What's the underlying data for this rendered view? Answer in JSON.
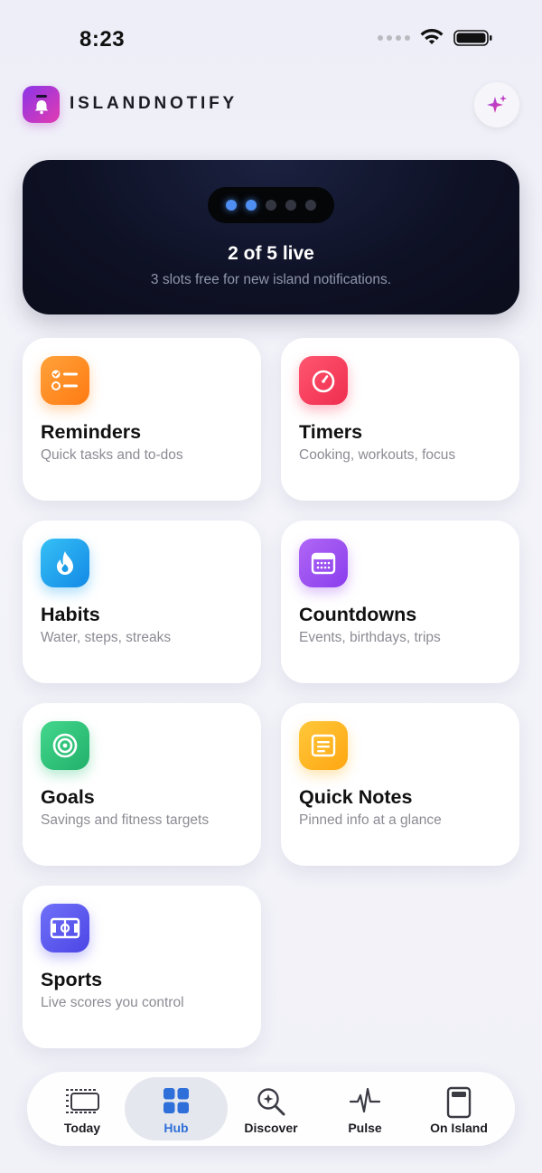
{
  "status_bar": {
    "time": "8:23"
  },
  "app": {
    "name": "ISLANDNOTIFY"
  },
  "island": {
    "live_count": "2 of 5 live",
    "subtitle": "3 slots free for new island notifications.",
    "slots_live": 2,
    "slots_total": 5
  },
  "categories": [
    {
      "title": "Reminders",
      "subtitle": "Quick tasks and to-dos",
      "icon": "checklist-icon",
      "color": "#ff8a1f"
    },
    {
      "title": "Timers",
      "subtitle": "Cooking, workouts, focus",
      "icon": "timer-icon",
      "color": "#f53b5a"
    },
    {
      "title": "Habits",
      "subtitle": "Water, steps, streaks",
      "icon": "flame-icon",
      "color": "#1aa3ee"
    },
    {
      "title": "Countdowns",
      "subtitle": "Events, birthdays, trips",
      "icon": "calendar-icon",
      "color": "#9a4ff0"
    },
    {
      "title": "Goals",
      "subtitle": "Savings and fitness targets",
      "icon": "target-icon",
      "color": "#2fc27a"
    },
    {
      "title": "Quick Notes",
      "subtitle": "Pinned info at a glance",
      "icon": "note-icon",
      "color": "#ffb51c"
    },
    {
      "title": "Sports",
      "subtitle": "Live scores you control",
      "icon": "sports-field-icon",
      "color": "#5b57f0"
    }
  ],
  "tabs": [
    {
      "label": "Today",
      "icon": "today-icon",
      "active": false
    },
    {
      "label": "Hub",
      "icon": "grid-icon",
      "active": true
    },
    {
      "label": "Discover",
      "icon": "discover-icon",
      "active": false
    },
    {
      "label": "Pulse",
      "icon": "pulse-icon",
      "active": false
    },
    {
      "label": "On Island",
      "icon": "phone-island-icon",
      "active": false
    }
  ],
  "colors": {
    "accent": "#2f6fd9",
    "logo_gradient": [
      "#8b35e8",
      "#e23bb0"
    ],
    "island_background": "#0e1124",
    "live_dot": "#4f8ff2"
  }
}
